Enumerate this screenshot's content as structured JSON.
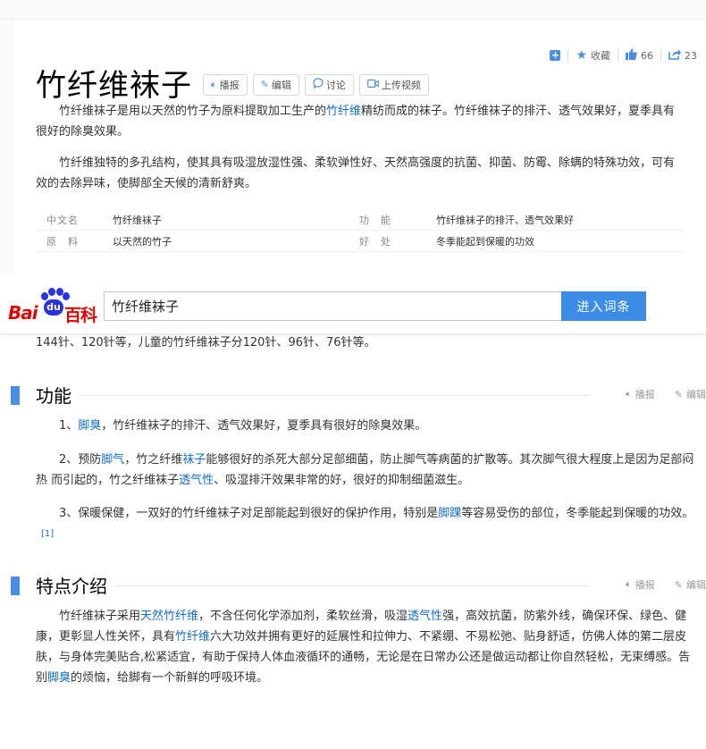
{
  "header": {
    "actions": {
      "collect_label": "收藏",
      "like_count": "66",
      "share_count": "23"
    },
    "title": "竹纤维袜子",
    "tools": {
      "play": "播报",
      "edit": "编辑",
      "discuss": "讨论",
      "upload_video": "上传视频"
    }
  },
  "summary": {
    "p1": {
      "before": "竹纤维袜子是用以天然的竹子为原料提取加工生产的",
      "link": "竹纤维",
      "after": "精纺而成的袜子。竹纤维袜子的排汗、透气效果好，夏季具有很好的除臭效果。"
    },
    "p2": "竹纤维独特的多孔结构，使其具有吸湿放湿性强、柔软弹性好、天然高强度的抗菌、抑菌、防霉、除螨的特殊功效，可有效的去除异味，使脚部全天候的清新舒爽。"
  },
  "basic_info": [
    {
      "k1": "中文名",
      "v1": "竹纤维袜子",
      "k2": "功　能",
      "v2": "竹纤维袜子的排汗、透气效果好"
    },
    {
      "k1": "原　料",
      "v1": "以天然的竹子",
      "k2": "好　处",
      "v2": "冬季能起到保暖的功效"
    }
  ],
  "search": {
    "logo_bai": "Bai",
    "logo_du": "du",
    "logo_ke": "百科",
    "query": "竹纤维袜子",
    "button": "进入词条"
  },
  "cont_line": "144针、120针等，儿童的竹纤维袜子分120针、96针、76针等。",
  "section_tools": {
    "play": "播报",
    "edit": "编辑"
  },
  "function_section": {
    "heading": "功能",
    "p1": {
      "before": "1、",
      "link": "脚臭",
      "after": "，竹纤维袜子的排汗、透气效果好，夏季具有很好的除臭效果。"
    },
    "p2": {
      "a": "2、预防",
      "l1": "脚气",
      "b": "，竹之纤维",
      "l2": "袜子",
      "c": "能够很好的杀死大部分足部细菌，防止脚气等病菌的扩散等。其次脚气很大程度上是因为足部闷热 而引起的，竹之纤维袜子",
      "l3": "透气性",
      "d": "、吸湿排汗效果非常的好，很好的抑制细菌滋生。"
    },
    "p3": {
      "a": "3、保暖保健，一双好的竹纤维袜子对足部能起到很好的保护作用，特别是",
      "l1": "脚踝",
      "b": "等容易受伤的部位，冬季能起到保暖的功效。",
      "ref": "[1]"
    }
  },
  "feature_section": {
    "heading": "特点介绍",
    "p": {
      "a": "竹纤维袜子采用",
      "l1": "天然竹纤维",
      "b": "，不含任何化学添加剂，柔软丝滑，吸湿",
      "l2": "透气性",
      "c": "强，高效抗菌，防紫外线，确保环保、绿色、健康，更彰显人性关怀，具有",
      "l3": "竹纤维",
      "d": "六大功效并拥有更好的延展性和拉伸力、不紧绷、不易松弛、贴身舒适，仿佛人体的第二层皮肤，与身体完美贴合,松紧适宜，有助于保持人体血液循环的通畅，无论是在日常办公还是做运动都让你自然轻松，无束缚感。告别",
      "l4": "脚臭",
      "e": "的烦恼，给脚有一个新鲜的呼吸环境。"
    }
  }
}
